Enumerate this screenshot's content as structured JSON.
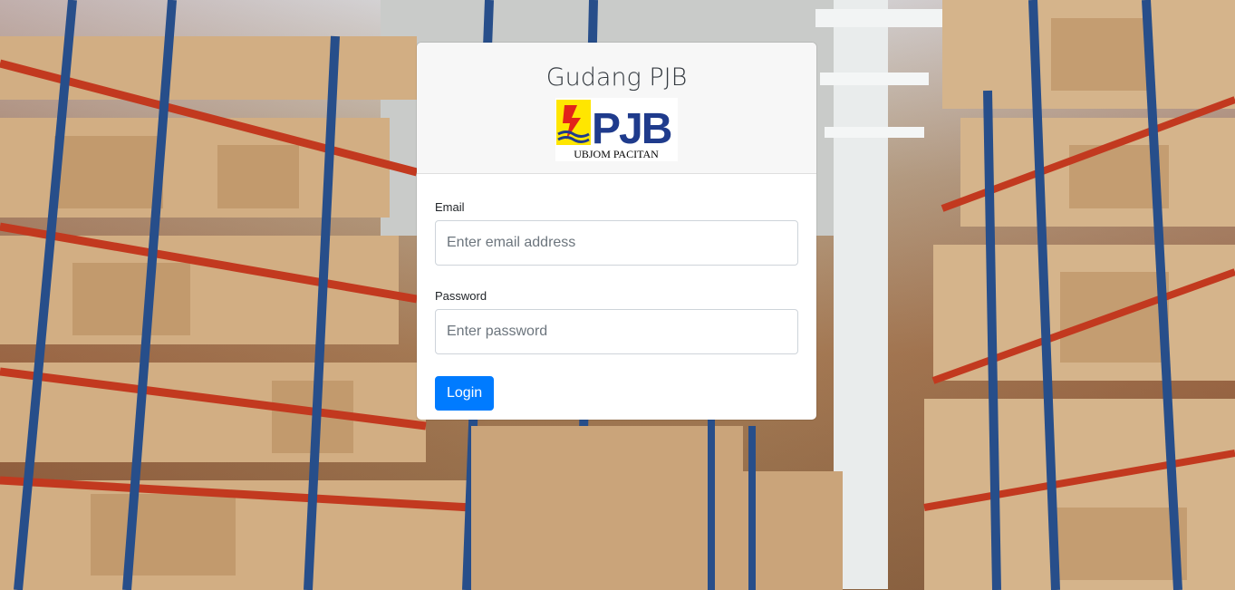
{
  "app": {
    "title": "Gudang PJB",
    "logo": {
      "brand": "PJB",
      "subtitle": "UBJOM PACITAN",
      "icon": "lightning-logo-icon",
      "colors": {
        "brand_blue": "#1f3b8c",
        "logo_yellow": "#ffe600",
        "logo_red": "#e2231a"
      }
    }
  },
  "form": {
    "email": {
      "label": "Email",
      "placeholder": "Enter email address",
      "value": ""
    },
    "password": {
      "label": "Password",
      "placeholder": "Enter password",
      "value": ""
    },
    "submit_label": "Login"
  },
  "theme": {
    "primary": "#007bff",
    "header_bg": "#f7f7f7",
    "background": "warehouse-photo"
  }
}
